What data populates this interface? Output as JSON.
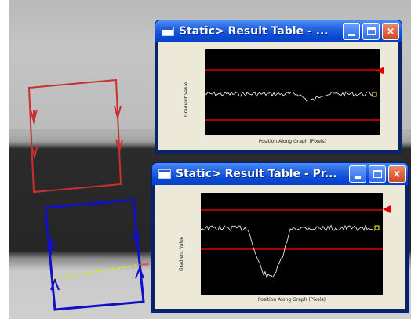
{
  "windows": [
    {
      "title": "Static> Result Table - ...",
      "buttons": {
        "minimize": "minimize",
        "maximize": "maximize",
        "close": "×"
      },
      "graph": {
        "ylabel": "Gradient Value",
        "xlabel": "Position Along Graph (Pixels)"
      }
    },
    {
      "title": "Static> Result Table - Pr...",
      "buttons": {
        "minimize": "minimize",
        "maximize": "maximize",
        "close": "×"
      },
      "graph": {
        "ylabel": "Gradient Value",
        "xlabel": "Position Along Graph (Pixels)"
      }
    }
  ],
  "colors": {
    "title_blue": "#0a4bd8",
    "threshold_red": "#e00000",
    "trace_white": "#ffffff",
    "marker_yellow": "#ffff00",
    "roi_red": "#c83030",
    "roi_blue": "#1010c8",
    "scan_line": "#d8e020"
  },
  "icons": [
    "window-app-icon",
    "minimize-icon",
    "maximize-icon",
    "close-icon",
    "threshold-marker-icon"
  ]
}
